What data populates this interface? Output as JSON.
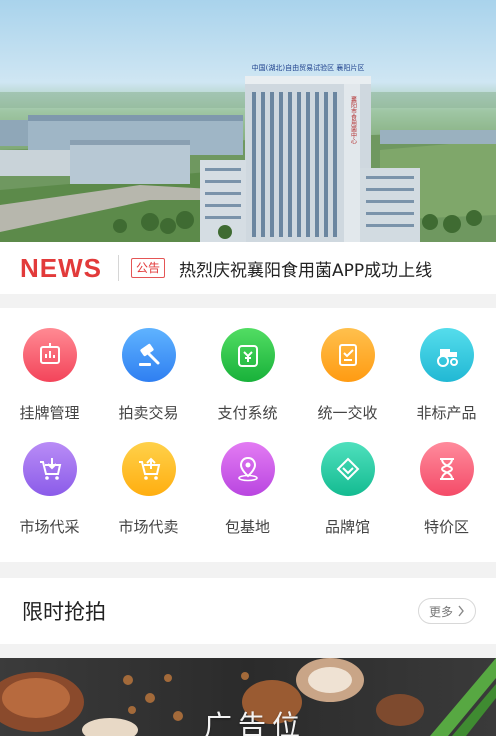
{
  "banner": {
    "sign_text": "中国(湖北)自由贸易试验区 襄阳片区",
    "vertical_text": "襄阳市食用菌中心"
  },
  "news": {
    "logo": "NEWS",
    "badge": "公告",
    "headline": "热烈庆祝襄阳食用菌APP成功上线"
  },
  "menu": [
    {
      "label": "挂牌管理",
      "icon": "listing-board-icon",
      "color_top": "#ff8a93",
      "color_bottom": "#f3445a"
    },
    {
      "label": "拍卖交易",
      "icon": "auction-gavel-icon",
      "color_top": "#5fb3ff",
      "color_bottom": "#2f7ff1"
    },
    {
      "label": "支付系统",
      "icon": "payment-card-icon",
      "color_top": "#52dd63",
      "color_bottom": "#18b13a"
    },
    {
      "label": "统一交收",
      "icon": "delivery-checklist-icon",
      "color_top": "#ffc04d",
      "color_bottom": "#ff9b12"
    },
    {
      "label": "非标产品",
      "icon": "tractor-icon",
      "color_top": "#55ddec",
      "color_bottom": "#21b8d4"
    },
    {
      "label": "市场代采",
      "icon": "cart-download-icon",
      "color_top": "#b98cf6",
      "color_bottom": "#8b5ce9"
    },
    {
      "label": "市场代卖",
      "icon": "cart-upload-icon",
      "color_top": "#ffd14a",
      "color_bottom": "#ffae10"
    },
    {
      "label": "包基地",
      "icon": "location-pin-icon",
      "color_top": "#e37cf3",
      "color_bottom": "#b946e0"
    },
    {
      "label": "品牌馆",
      "icon": "brand-diamond-icon",
      "color_top": "#4fe0bd",
      "color_bottom": "#14bb91"
    },
    {
      "label": "特价区",
      "icon": "hourglass-icon",
      "color_top": "#ff8b9c",
      "color_bottom": "#f44b68"
    }
  ],
  "flash_sale": {
    "title": "限时抢拍",
    "more_label": "更多"
  },
  "ad": {
    "text": "广告位"
  }
}
